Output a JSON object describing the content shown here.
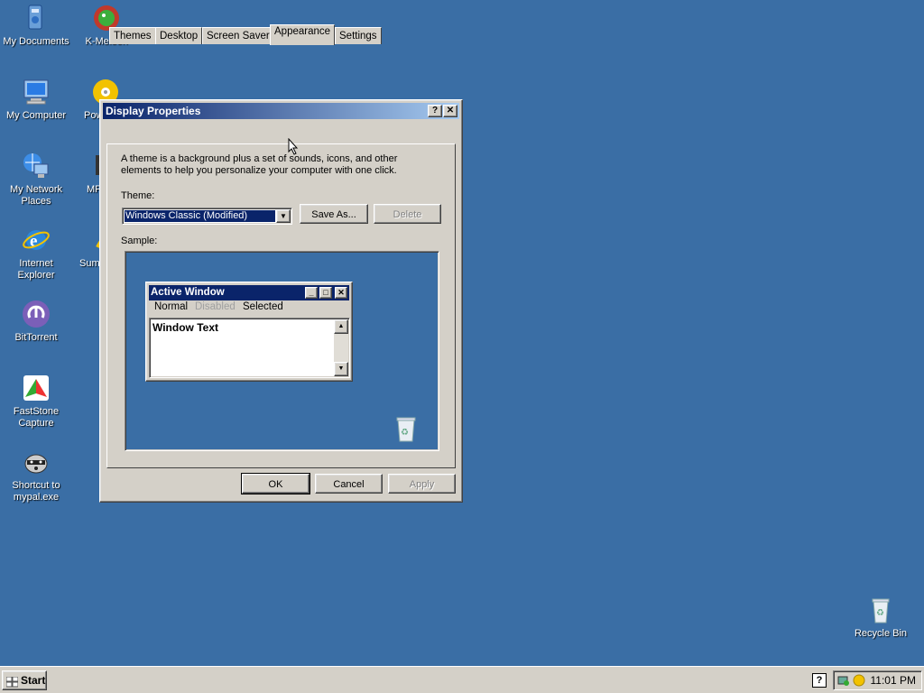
{
  "desktop": {
    "icons": [
      {
        "label": "My Documents",
        "icon": "my-documents-icon"
      },
      {
        "label": "K-Meleon",
        "icon": "k-meleon-icon"
      },
      {
        "label": "My Computer",
        "icon": "my-computer-icon"
      },
      {
        "label": "Pow",
        "icon": "power-dvd-icon"
      },
      {
        "label": "My Network Places",
        "icon": "network-places-icon"
      },
      {
        "label": "MF",
        "icon": "mf-icon"
      },
      {
        "label": "Internet Explorer",
        "icon": "internet-explorer-icon"
      },
      {
        "label": "Sum",
        "icon": "sum-icon"
      },
      {
        "label": "BitTorrent",
        "icon": "bittorrent-icon"
      },
      {
        "label": "FastStone Capture",
        "icon": "faststone-icon"
      },
      {
        "label": "Shortcut to mypal.exe",
        "icon": "mypal-icon"
      },
      {
        "label": "Recycle Bin",
        "icon": "recycle-bin-icon"
      }
    ]
  },
  "dialog": {
    "title": "Display Properties",
    "help_glyph": "?",
    "close_glyph": "✕",
    "tabs": [
      {
        "label": "Themes",
        "active": false
      },
      {
        "label": "Desktop",
        "active": false
      },
      {
        "label": "Screen Saver",
        "active": false
      },
      {
        "label": "Appearance",
        "active": true
      },
      {
        "label": "Settings",
        "active": false
      }
    ],
    "description": "A theme is a background plus a set of sounds, icons, and other elements to help you personalize your computer with one click.",
    "theme_label": "Theme:",
    "theme_value": "Windows Classic (Modified)",
    "save_as_label": "Save As...",
    "delete_label": "Delete",
    "sample_label": "Sample:",
    "sample": {
      "window_title": "Active Window",
      "menu_normal": "Normal",
      "menu_disabled": "Disabled",
      "menu_selected": "Selected",
      "window_text": "Window Text"
    },
    "ok_label": "OK",
    "cancel_label": "Cancel",
    "apply_label": "Apply"
  },
  "taskbar": {
    "start_label": "Start",
    "clock": "11:01 PM"
  },
  "colors": {
    "desktop": "#3a6ea5",
    "titlebar": "#0a246a",
    "face": "#d4d0c8"
  }
}
